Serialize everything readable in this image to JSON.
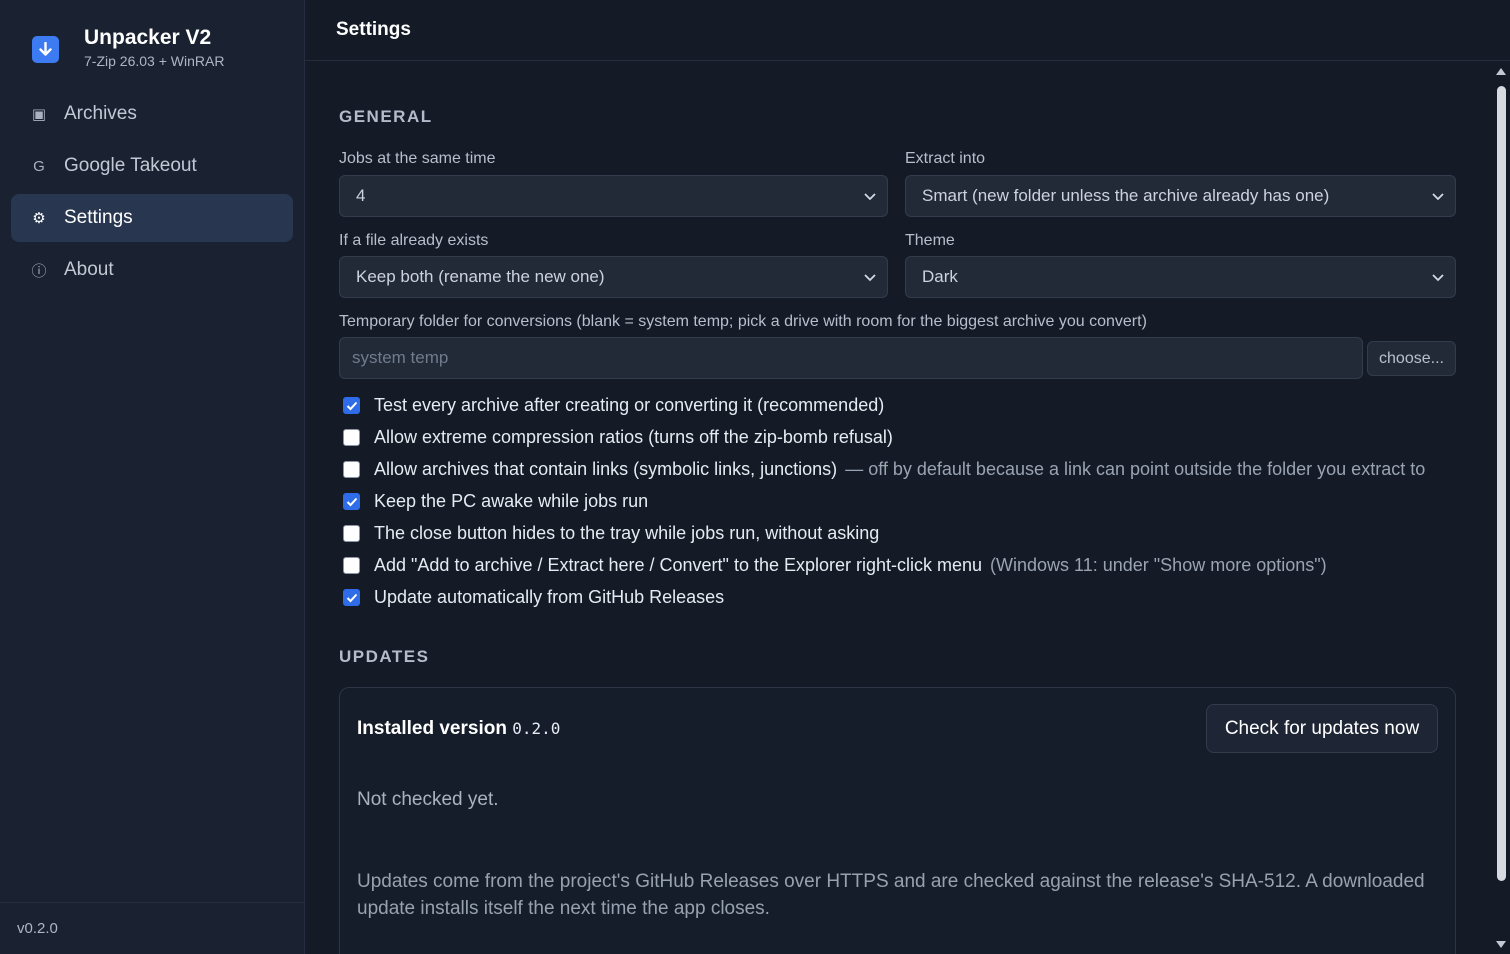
{
  "app": {
    "name": "Unpacker V2",
    "subtitle": "7-Zip 26.03 + WinRAR",
    "version_footer": "v0.2.0"
  },
  "sidebar": {
    "items": [
      {
        "label": "Archives",
        "icon": "square-icon",
        "glyph": "▣",
        "active": false
      },
      {
        "label": "Google Takeout",
        "icon": "google-letter-icon",
        "glyph": "G",
        "active": false
      },
      {
        "label": "Settings",
        "icon": "gear-icon",
        "glyph": "⚙",
        "active": true
      },
      {
        "label": "About",
        "icon": "info-icon",
        "glyph": "ⓘ",
        "active": false
      }
    ]
  },
  "header": {
    "title": "Settings"
  },
  "general": {
    "section_title": "GENERAL",
    "jobs": {
      "label": "Jobs at the same time",
      "value": "4"
    },
    "extract_into": {
      "label": "Extract into",
      "value": "Smart (new folder unless the archive already has one)"
    },
    "file_exists": {
      "label": "If a file already exists",
      "value": "Keep both (rename the new one)"
    },
    "theme": {
      "label": "Theme",
      "value": "Dark"
    },
    "temp_folder": {
      "label": "Temporary folder for conversions (blank = system temp; pick a drive with room for the biggest archive you convert)",
      "placeholder": "system temp",
      "choose_label": "choose..."
    },
    "checkboxes": [
      {
        "label": "Test every archive after creating or converting it (recommended)",
        "hint": "",
        "checked": true
      },
      {
        "label": "Allow extreme compression ratios (turns off the zip-bomb refusal)",
        "hint": "",
        "checked": false
      },
      {
        "label": "Allow archives that contain links (symbolic links, junctions)",
        "hint": "— off by default because a link can point outside the folder you extract to",
        "checked": false
      },
      {
        "label": "Keep the PC awake while jobs run",
        "hint": "",
        "checked": true
      },
      {
        "label": "The close button hides to the tray while jobs run, without asking",
        "hint": "",
        "checked": false
      },
      {
        "label": "Add \"Add to archive / Extract here / Convert\" to the Explorer right-click menu",
        "hint": "(Windows 11: under \"Show more options\")",
        "checked": false
      },
      {
        "label": "Update automatically from GitHub Releases",
        "hint": "",
        "checked": true
      }
    ]
  },
  "updates": {
    "section_title": "UPDATES",
    "installed_label": "Installed version",
    "installed_version": "0.2.0",
    "check_button": "Check for updates now",
    "status": "Not checked yet.",
    "note": "Updates come from the project's GitHub Releases over HTTPS and are checked against the release's SHA-512. A downloaded update installs itself the next time the app closes."
  },
  "colors": {
    "background": "#141b27",
    "sidebar": "#1a2130",
    "active_nav": "#283650",
    "accent": "#3d7bf2",
    "checkbox_checked": "#2f6de8"
  }
}
